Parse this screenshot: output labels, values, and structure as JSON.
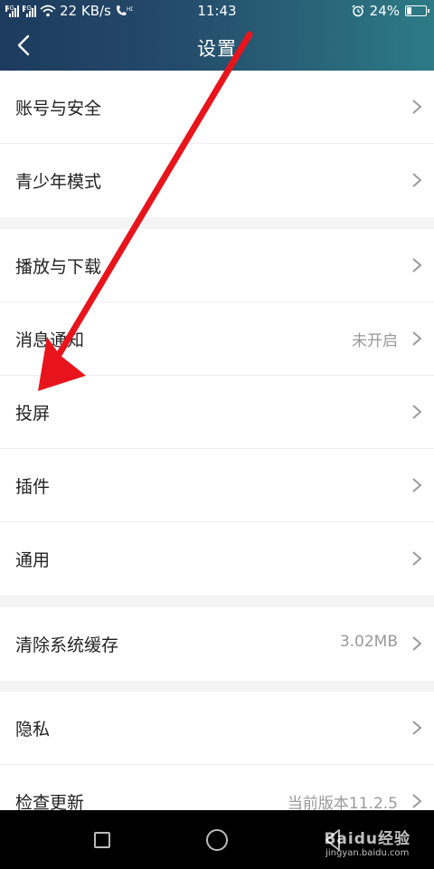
{
  "status_bar": {
    "net_tag_1": "4G",
    "net_tag_2": "2G",
    "speed": "22 KB/s",
    "time": "11:43",
    "battery_percent": "24%",
    "battery_level": 0.24,
    "icons": [
      "signal-icon",
      "wifi-icon",
      "hd-call-icon",
      "alarm-icon",
      "battery-icon"
    ]
  },
  "header": {
    "title": "设置",
    "back_icon": "chevron-left-icon"
  },
  "groups": [
    {
      "rows": [
        {
          "label": "账号与安全",
          "value": ""
        },
        {
          "label": "青少年模式",
          "value": ""
        }
      ]
    },
    {
      "rows": [
        {
          "label": "播放与下载",
          "value": ""
        },
        {
          "label": "消息通知",
          "value": "未开启"
        },
        {
          "label": "投屏",
          "value": ""
        },
        {
          "label": "插件",
          "value": ""
        },
        {
          "label": "通用",
          "value": ""
        }
      ]
    },
    {
      "rows": [
        {
          "label": "清除系统缓存",
          "value": "3.02MB"
        }
      ]
    },
    {
      "rows": [
        {
          "label": "隐私",
          "value": ""
        },
        {
          "label": "检查更新",
          "value": "当前版本11.2.5"
        }
      ]
    }
  ],
  "nav_bar": {
    "icons": [
      "recent-apps-icon",
      "home-icon",
      "back-triangle-icon"
    ]
  },
  "watermark": {
    "brand": "Baidu经验",
    "url": "jingyan.baidu.com"
  },
  "colors": {
    "header_start": "#1d3b5e",
    "header_end": "#2d7b86",
    "arrow": "#e8141c",
    "value_text": "#999999"
  }
}
